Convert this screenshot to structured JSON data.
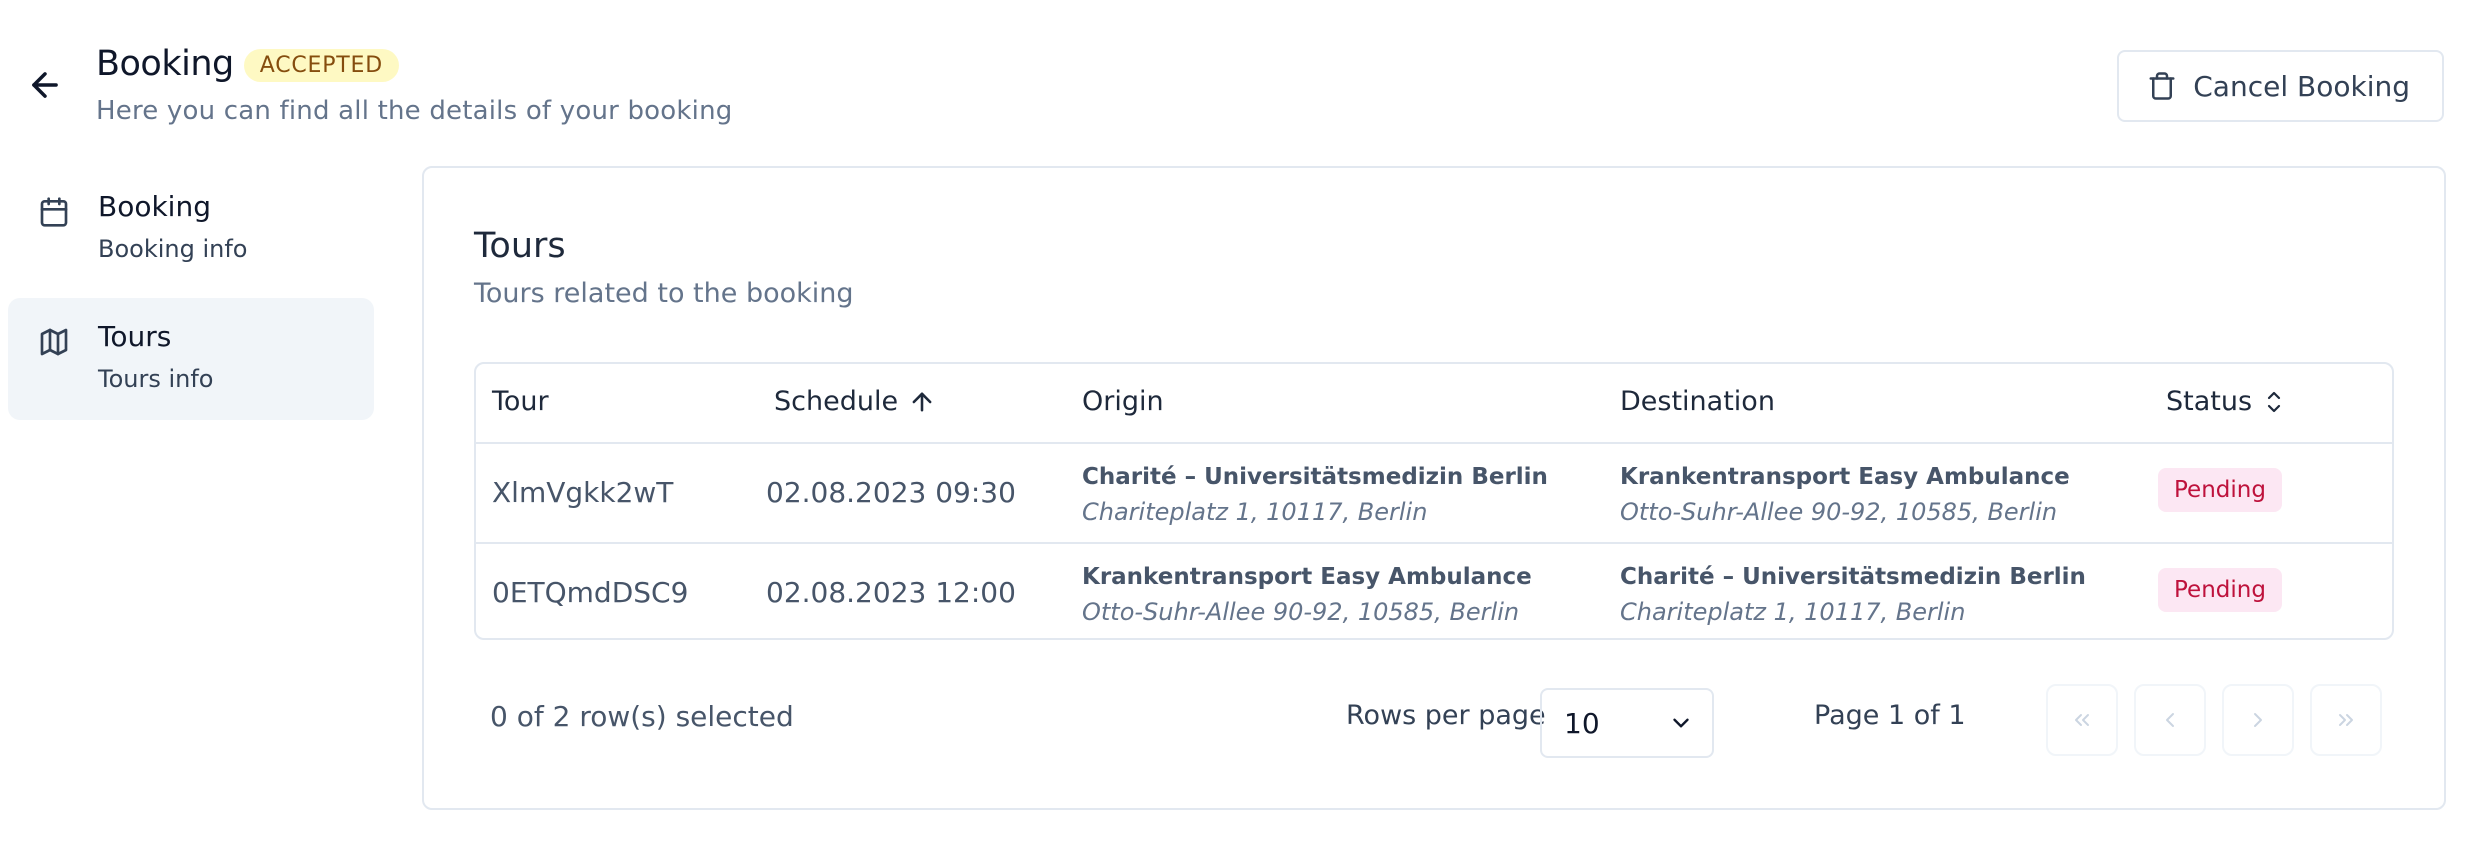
{
  "header": {
    "title": "Booking",
    "status": "ACCEPTED",
    "subtitle": "Here you can find all the details of your booking",
    "cancel_label": "Cancel Booking"
  },
  "sidebar": {
    "items": [
      {
        "label": "Booking",
        "sub": "Booking info",
        "icon": "calendar-icon"
      },
      {
        "label": "Tours",
        "sub": "Tours info",
        "icon": "map-icon",
        "active": true
      }
    ]
  },
  "tours": {
    "title": "Tours",
    "subtitle": "Tours related to the booking",
    "columns": {
      "tour": "Tour",
      "schedule": "Schedule",
      "origin": "Origin",
      "destination": "Destination",
      "status": "Status"
    },
    "rows": [
      {
        "tour": "XlmVgkk2wT",
        "schedule": "02.08.2023 09:30",
        "origin_name": "Charité – Universitätsmedizin Berlin",
        "origin_addr": "Chariteplatz 1, 10117, Berlin",
        "dest_name": "Krankentransport Easy Ambulance",
        "dest_addr": "Otto-Suhr-Allee 90-92, 10585, Berlin",
        "status": "Pending"
      },
      {
        "tour": "0ETQmdDSC9",
        "schedule": "02.08.2023 12:00",
        "origin_name": "Krankentransport Easy Ambulance",
        "origin_addr": "Otto-Suhr-Allee 90-92, 10585, Berlin",
        "dest_name": "Charité – Universitätsmedizin Berlin",
        "dest_addr": "Chariteplatz 1, 10117, Berlin",
        "status": "Pending"
      }
    ],
    "footer": {
      "selected": "0 of 2 row(s) selected",
      "rows_per_page_label": "Rows per page",
      "rows_per_page_value": "10",
      "page_label": "Page 1 of 1"
    }
  },
  "colors": {
    "accepted_bg": "#fef9c3",
    "accepted_text": "#854d0e",
    "pending_bg": "#fce7f3",
    "pending_text": "#be123c",
    "border": "#e2e8f0"
  }
}
